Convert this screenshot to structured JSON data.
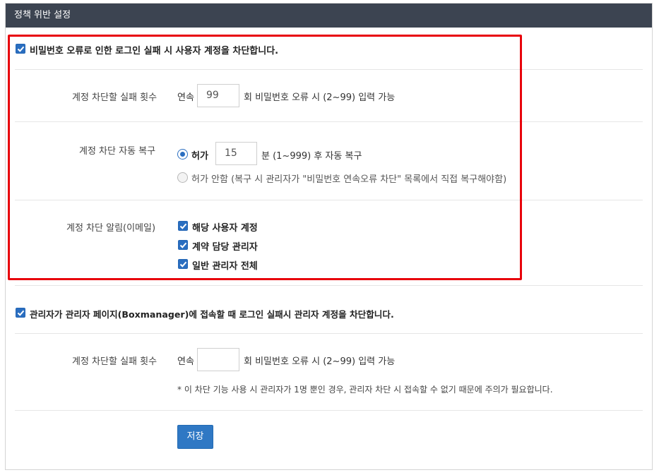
{
  "header": {
    "title": "정책 위반 설정"
  },
  "section1": {
    "checkbox_label": "비밀번호 오류로 인한 로그인 실패 시 사용자 계정을 차단합니다.",
    "checked": true,
    "fail_count": {
      "label": "계정 차단할 실패 횟수",
      "prefix": "연속",
      "value": "99",
      "suffix": "회 비밀번호 오류 시 (2~99) 입력 가능"
    },
    "auto_restore": {
      "label": "계정 차단 자동 복구",
      "allow_label": "허가",
      "minutes_value": "15",
      "minutes_suffix": "분 (1~999) 후 자동 복구",
      "deny_label": "허가 안함 (복구 시 관리자가 \"비밀번호 연속오류 차단\" 목록에서 직접 복구해야함)",
      "selected": "allow"
    },
    "notify": {
      "label": "계정 차단 알림(이메일)",
      "options": [
        {
          "label": "해당 사용자 계정",
          "checked": true
        },
        {
          "label": "계약 담당 관리자",
          "checked": true
        },
        {
          "label": "일반 관리자 전체",
          "checked": true
        }
      ]
    }
  },
  "section2": {
    "checkbox_label": "관리자가 관리자 페이지(Boxmanager)에 접속할 때 로그인 실패시 관리자 계정을 차단합니다.",
    "checked": true,
    "fail_count": {
      "label": "계정 차단할 실패 횟수",
      "prefix": "연속",
      "value": "",
      "suffix": "회 비밀번호 오류 시 (2~99) 입력 가능"
    },
    "note": "* 이 차단 기능 사용 시 관리자가 1명 뿐인 경우, 관리자 차단 시 접속할 수 없기 때문에 주의가 필요합니다."
  },
  "save_button": {
    "label": "저장"
  },
  "colors": {
    "header_bg": "#3c4451",
    "accent": "#2a6ec0",
    "highlight_border": "#e8000b"
  }
}
